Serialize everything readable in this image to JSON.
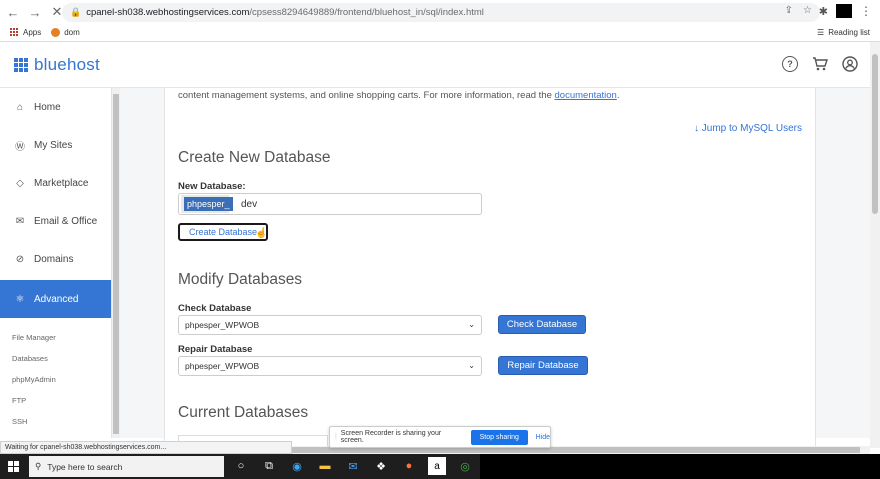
{
  "browser": {
    "url_host": "cpanel-sh038.webhostingservices.com",
    "url_path": "/cpsess8294649889/frontend/bluehost_in/sql/index.html",
    "bookmarks": [
      "Apps",
      "dom"
    ],
    "reading_list": "Reading list",
    "status_text": "Waiting for cpanel-sh038.webhostingservices.com..."
  },
  "header": {
    "logo_text": "bluehost"
  },
  "sidebar": {
    "items": [
      {
        "label": "Home",
        "icon": "home-icon"
      },
      {
        "label": "My Sites",
        "icon": "wordpress-icon"
      },
      {
        "label": "Marketplace",
        "icon": "tag-icon"
      },
      {
        "label": "Email & Office",
        "icon": "mail-icon"
      },
      {
        "label": "Domains",
        "icon": "compass-icon"
      },
      {
        "label": "Advanced",
        "icon": "atom-icon",
        "active": true
      }
    ],
    "subitems": [
      "File Manager",
      "Databases",
      "phpMyAdmin",
      "FTP",
      "SSH"
    ]
  },
  "main": {
    "intro_text": "content management systems, and online shopping carts. For more information, read the",
    "intro_link": "documentation",
    "intro_end": ".",
    "jump_link": "↓ Jump to MySQL Users",
    "create": {
      "heading": "Create New Database",
      "label": "New Database:",
      "prefix": "phpesper_",
      "value": "dev",
      "button": "Create Database"
    },
    "modify": {
      "heading": "Modify Databases",
      "check_label": "Check Database",
      "check_selected": "phpesper_WPWOB",
      "check_button": "Check Database",
      "repair_label": "Repair Database",
      "repair_selected": "phpesper_WPWOB",
      "repair_button": "Repair Database"
    },
    "current": {
      "heading": "Current Databases"
    }
  },
  "share_banner": {
    "text": "Screen Recorder is sharing your screen.",
    "stop": "Stop sharing",
    "hide": "Hide"
  },
  "taskbar": {
    "search_placeholder": "Type here to search"
  },
  "colors": {
    "brand": "#3575d3",
    "taskbar": "#1e1e1e"
  }
}
